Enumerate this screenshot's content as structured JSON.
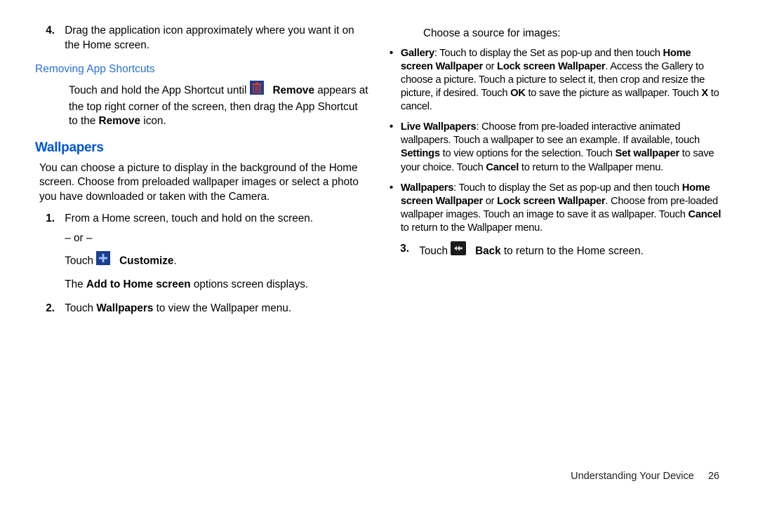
{
  "left": {
    "step4_num": "4.",
    "step4": "Drag the application icon approximately where you want it on the Home screen.",
    "subhead": "Removing App Shortcuts",
    "removing_a": "Touch and hold the App Shortcut until ",
    "removing_b_bold": "Remove",
    "removing_c": " appears at the top right corner of the screen, then drag the App Shortcut to the ",
    "removing_d_bold": "Remove",
    "removing_e": " icon.",
    "h2": "Wallpapers",
    "intro": "You can choose a picture to display in the background of the Home screen. Choose from preloaded wallpaper images or select a photo you have downloaded or taken with the Camera.",
    "s1_num": "1.",
    "s1_a": "From a Home screen, touch and hold on the screen.",
    "s1_or": "– or –",
    "s1_touch": "Touch ",
    "s1_customize": "Customize",
    "s1_dot": ".",
    "s1_add1": "The ",
    "s1_add2": "Add to Home screen",
    "s1_add3": " options screen displays.",
    "s2_num": "2.",
    "s2_a": "Touch ",
    "s2_b": "Wallpapers",
    "s2_c": " to view the Wallpaper menu."
  },
  "right": {
    "choose": "Choose a source for images:",
    "g_label": "Gallery",
    "g_a": ": Touch to display the Set as pop-up and then touch ",
    "g_b": "Home screen Wallpaper",
    "g_or": " or ",
    "g_c": "Lock screen Wallpaper",
    "g_d": ". Access the Gallery to choose a picture. Touch a picture to select it, then crop and resize the picture, if desired. Touch ",
    "g_ok": "OK",
    "g_e": " to save the picture as wallpaper. Touch ",
    "g_x": "X",
    "g_f": " to cancel.",
    "l_label": "Live Wallpapers",
    "l_a": ": Choose from pre-loaded interactive animated wallpapers. Touch a wallpaper to see an example. If available, touch ",
    "l_settings": "Settings",
    "l_b": " to view options for the selection. Touch ",
    "l_set": "Set wallpaper",
    "l_c": " to save your choice. Touch ",
    "l_cancel": "Cancel",
    "l_d": " to return to the Wallpaper menu.",
    "w_label": "Wallpapers",
    "w_a": ": Touch to display the Set as pop-up and then touch ",
    "w_b": "Home screen Wallpaper",
    "w_or": " or ",
    "w_c": "Lock screen Wallpaper",
    "w_d": ". Choose from pre-loaded wallpaper images. Touch an image to save it as wallpaper. Touch ",
    "w_cancel": "Cancel",
    "w_e": " to return to the Wallpaper menu.",
    "s3_num": "3.",
    "s3_a": "Touch ",
    "s3_back": "Back",
    "s3_b": " to return to the Home screen."
  },
  "footer": {
    "section": "Understanding Your Device",
    "page": "26"
  }
}
